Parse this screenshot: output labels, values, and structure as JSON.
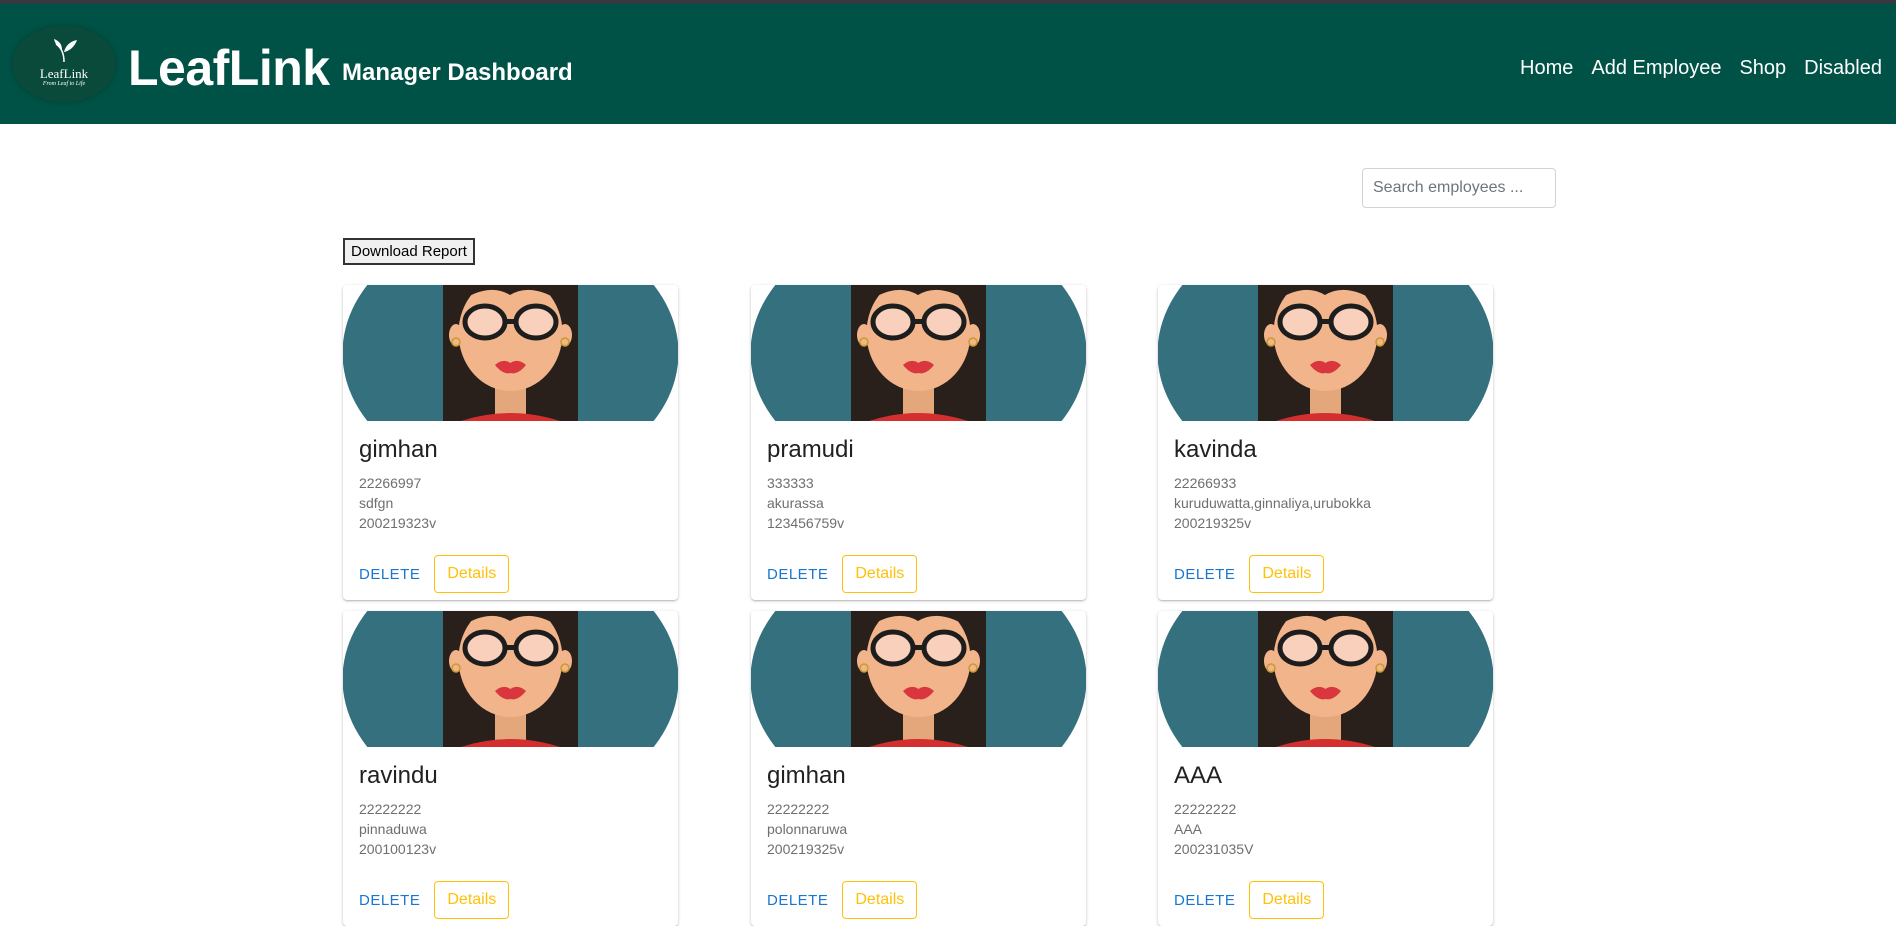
{
  "header": {
    "logo_text": "LeafLink",
    "logo_tagline": "From Leaf to Life",
    "brand": "LeafLink",
    "subtitle": "Manager Dashboard",
    "nav": [
      "Home",
      "Add Employee",
      "Shop",
      "Disabled"
    ]
  },
  "search": {
    "placeholder": "Search employees ..."
  },
  "report_button": "Download Report",
  "card_actions": {
    "delete": "DELETE",
    "details": "Details"
  },
  "employees": [
    {
      "name": "gimhan",
      "phone": "22266997",
      "address": "sdfgn",
      "nic": "200219323v"
    },
    {
      "name": "pramudi",
      "phone": "333333",
      "address": "akurassa",
      "nic": "123456759v"
    },
    {
      "name": "kavinda",
      "phone": "22266933",
      "address": "kuruduwatta,ginnaliya,urubokka",
      "nic": "200219325v"
    },
    {
      "name": "ravindu",
      "phone": "22222222",
      "address": "pinnaduwa",
      "nic": "200100123v"
    },
    {
      "name": "gimhan",
      "phone": "22222222",
      "address": "polonnaruwa",
      "nic": "200219325v"
    },
    {
      "name": "AAA",
      "phone": "22222222",
      "address": "AAA",
      "nic": "200231035V"
    }
  ],
  "colors": {
    "navbar": "#005246",
    "avatar_bg": "#35707f",
    "delete": "#1976d2",
    "details": "#ffc107"
  }
}
